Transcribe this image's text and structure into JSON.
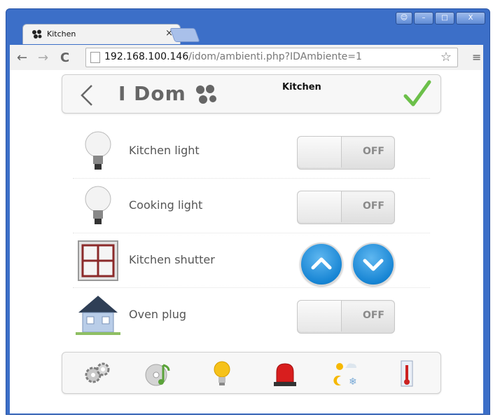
{
  "window": {
    "controls": [
      "user",
      "minimize",
      "maximize",
      "close"
    ]
  },
  "browser": {
    "tab_title": "Kitchen",
    "tab_close": "×",
    "url_host": "192.168.100.146",
    "url_path": "/idom/ambienti.php?IDAmbiente=1",
    "icons": [
      "back-arrow-icon",
      "forward-arrow-icon",
      "reload-icon",
      "page-icon",
      "star-icon",
      "menu-icon"
    ]
  },
  "app": {
    "logo_text": "I Dom",
    "title": "Kitchen",
    "colors": {
      "toggle_off_text": "#8a8a8a",
      "round_button": "#1785d4",
      "check": "#6cc04a"
    }
  },
  "rows": [
    {
      "label": "Kitchen light",
      "type": "toggle",
      "state": "OFF",
      "icon": "light-bulb-icon"
    },
    {
      "label": "Cooking light",
      "type": "toggle",
      "state": "OFF",
      "icon": "light-bulb-icon"
    },
    {
      "label": "Kitchen shutter",
      "type": "shutter",
      "icon": "window-shutter-icon",
      "up_icon": "chevron-up-icon",
      "down_icon": "chevron-down-icon"
    },
    {
      "label": "Oven plug",
      "type": "toggle",
      "state": "OFF",
      "icon": "house-icon"
    }
  ],
  "footer": {
    "icons": [
      "gears-icon",
      "music-cd-icon",
      "light-bulb-icon",
      "alarm-siren-icon",
      "weather-icon",
      "thermometer-icon"
    ]
  }
}
